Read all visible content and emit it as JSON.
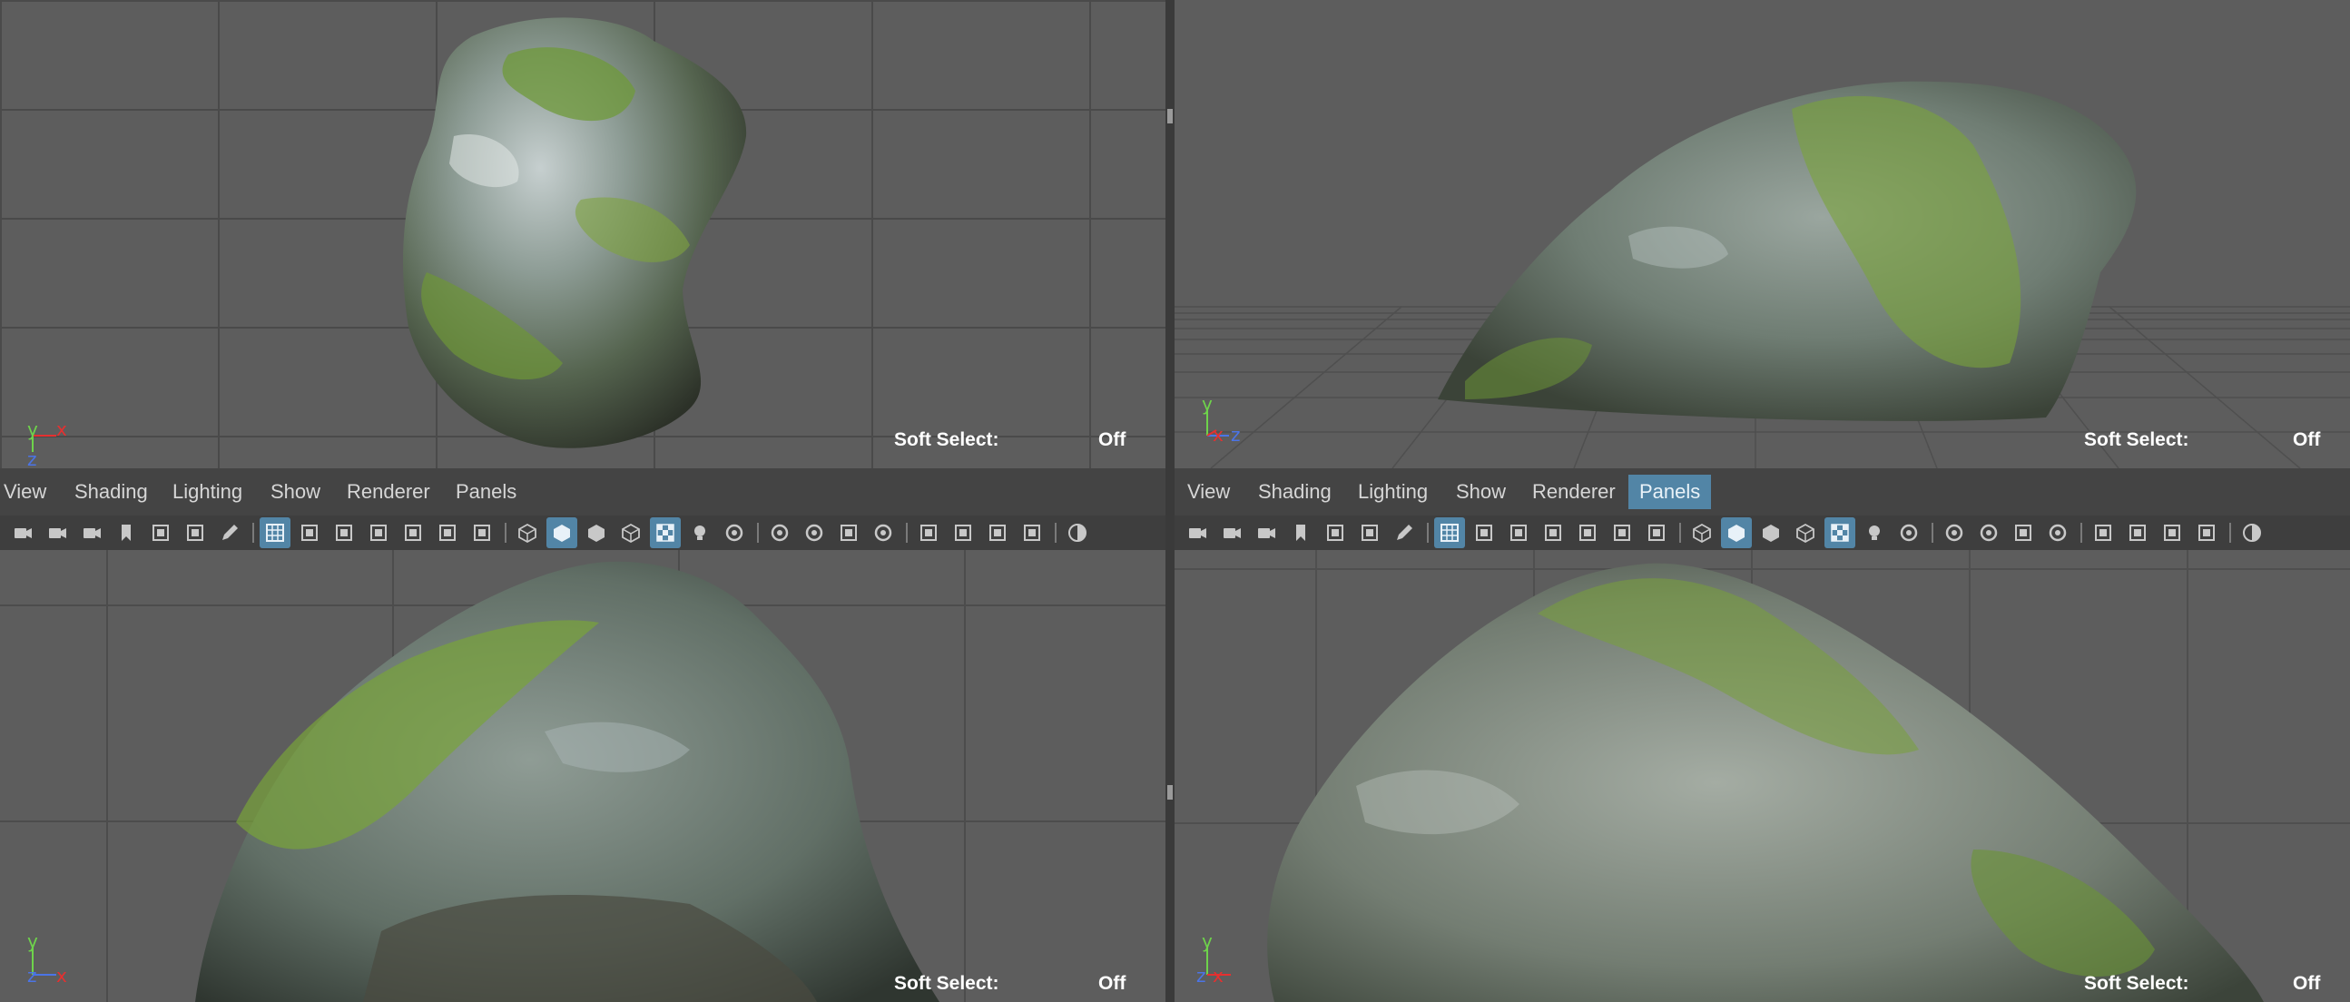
{
  "menus": {
    "left": [
      "View",
      "Shading",
      "Lighting",
      "Show",
      "Renderer",
      "Panels"
    ],
    "right": [
      "View",
      "Shading",
      "Lighting",
      "Show",
      "Renderer",
      "Panels"
    ],
    "right_active": "Panels"
  },
  "soft_select": {
    "label": "Soft Select:",
    "value": "Off"
  },
  "axes": {
    "x": "x",
    "y": "y",
    "z": "z"
  },
  "colors": {
    "accent": "#5285a6",
    "viewport_bg": "#5d5d5d",
    "axis_x": "#e53030",
    "axis_y": "#6ed34b",
    "axis_z": "#4b74e6"
  },
  "toolbar_icons": [
    "camera-icon",
    "lock-camera-icon",
    "camera-attributes-icon",
    "bookmark-icon",
    "image-plane-icon",
    "two-d-pan-zoom-icon",
    "grease-pencil-icon",
    "grid-icon",
    "film-gate-icon",
    "resolution-gate-icon",
    "gate-mask-icon",
    "field-chart-icon",
    "safe-action-icon",
    "safe-title-icon",
    "wireframe-icon",
    "smooth-shade-icon",
    "use-default-material-icon",
    "wireframe-on-shaded-icon",
    "textured-icon",
    "lights-icon",
    "shadows-icon",
    "screen-space-ao-icon",
    "motion-blur-icon",
    "multisample-aa-icon",
    "depth-of-field-icon",
    "isolate-select-icon",
    "xray-icon",
    "xray-active-components-icon",
    "xray-joints-icon",
    "exposure-icon"
  ]
}
